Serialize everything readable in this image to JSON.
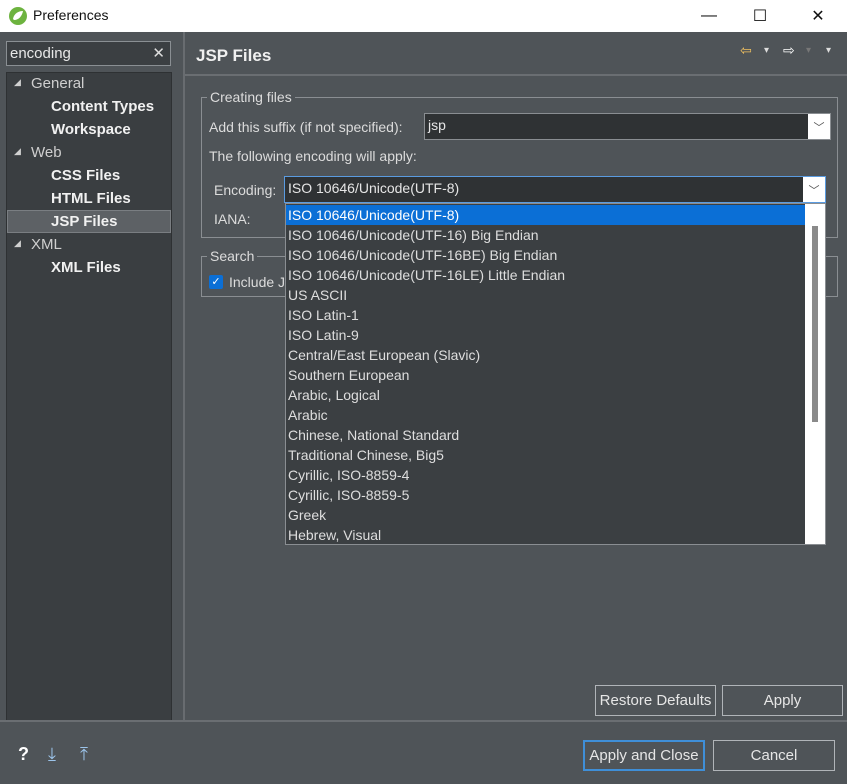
{
  "window": {
    "title": "Preferences",
    "minimize_glyph": "—",
    "maximize_glyph": "☐",
    "close_glyph": "✕"
  },
  "filter": {
    "value": "encoding",
    "clear_glyph": "✕"
  },
  "tree": {
    "items": [
      {
        "label": "General",
        "type": "group"
      },
      {
        "label": "Content Types",
        "type": "leaf"
      },
      {
        "label": "Workspace",
        "type": "leaf"
      },
      {
        "label": "Web",
        "type": "group"
      },
      {
        "label": "CSS Files",
        "type": "leaf"
      },
      {
        "label": "HTML Files",
        "type": "leaf"
      },
      {
        "label": "JSP Files",
        "type": "leaf",
        "selected": true
      },
      {
        "label": "XML",
        "type": "group"
      },
      {
        "label": "XML Files",
        "type": "leaf"
      }
    ]
  },
  "page": {
    "title": "JSP Files",
    "nav": {
      "back_glyph": "⇦",
      "back_menu_glyph": "▾",
      "forward_glyph": "⇨",
      "forward_menu_glyph": "▾",
      "view_menu_glyph": "▾"
    }
  },
  "creating_files": {
    "group_label": "Creating files",
    "suffix_label": "Add this suffix (if not specified):",
    "suffix_value": "jsp",
    "encoding_intro": "The following encoding will apply:",
    "encoding_label": "Encoding:",
    "encoding_value": "ISO 10646/Unicode(UTF-8)",
    "iana_label": "IANA:"
  },
  "search": {
    "group_label": "Search",
    "checkbox_label": "Include J",
    "checked": true
  },
  "encoding_options": [
    "ISO 10646/Unicode(UTF-8)",
    "ISO 10646/Unicode(UTF-16) Big Endian",
    "ISO 10646/Unicode(UTF-16BE) Big Endian",
    "ISO 10646/Unicode(UTF-16LE) Little Endian",
    "US ASCII",
    "ISO Latin-1",
    "ISO Latin-9",
    "Central/East European (Slavic)",
    "Southern European",
    "Arabic, Logical",
    "Arabic",
    "Chinese, National Standard",
    "Traditional Chinese, Big5",
    "Cyrillic, ISO-8859-4",
    "Cyrillic, ISO-8859-5",
    "Greek",
    "Hebrew, Visual"
  ],
  "buttons": {
    "restore_defaults": "Restore Defaults",
    "apply": "Apply",
    "apply_and_close": "Apply and Close",
    "cancel": "Cancel"
  },
  "footer": {
    "help_glyph": "?",
    "import_glyph": "⤓",
    "export_glyph": "⤒"
  },
  "colors": {
    "accent": "#0b6fd6",
    "background": "#4f5458",
    "tree_background": "#3a3e41"
  }
}
